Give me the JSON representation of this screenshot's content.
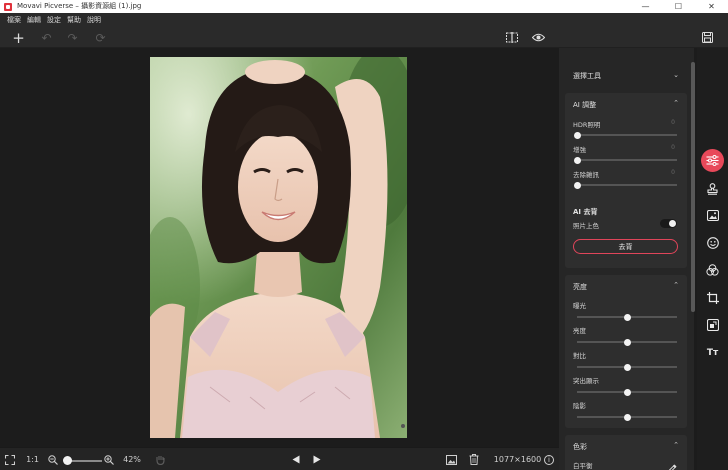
{
  "window": {
    "title": "Movavi Picverse – 攝影資源組 (1).jpg",
    "minimize": "—",
    "maximize": "☐",
    "close": "✕"
  },
  "menu": [
    "檔案",
    "編輯",
    "設定",
    "幫助",
    "說明"
  ],
  "toolbar": {
    "add": "+",
    "undo": "↶",
    "redo": "↷",
    "reset": "⟳",
    "compare": "◫",
    "preview": "◉",
    "save": "💾"
  },
  "bottom": {
    "zoom_ratio": "1:1",
    "zoom_out": "−",
    "zoom_in": "+",
    "zoom_level": "42%",
    "zoom_fraction": 0.05,
    "image_size": "1077×1600",
    "info": "i"
  },
  "panel": {
    "selection_tools": "選擇工具",
    "ai_adjust": {
      "title": "AI 調整",
      "sliders": [
        {
          "label": "HDR照明",
          "value": "0",
          "level": 0
        },
        {
          "label": "增強",
          "value": "0",
          "level": 0
        },
        {
          "label": "去除雜訊",
          "value": "0",
          "level": 0
        }
      ],
      "remove_bg_title": "AI 去背",
      "photo_colorize": "照片上色",
      "remove_button": "去背"
    },
    "brightness": {
      "title": "亮度",
      "sliders": [
        {
          "label": "曝光",
          "value": "0",
          "level": 0.5
        },
        {
          "label": "亮度",
          "value": "0",
          "level": 0.5
        },
        {
          "label": "對比",
          "value": "0",
          "level": 0.5
        },
        {
          "label": "突出顯示",
          "value": "0",
          "level": 0.5
        },
        {
          "label": "陰影",
          "value": "0",
          "level": 0.5
        }
      ]
    },
    "color": {
      "title": "色彩",
      "white_balance": "白平衡"
    }
  },
  "tools": [
    "adjust",
    "stamp",
    "image",
    "emoji",
    "color-circles",
    "crop",
    "transform",
    "text"
  ],
  "colors": {
    "accent": "#e8495a",
    "panel_bg": "#262626",
    "canvas_bg": "#1c1c1c"
  }
}
